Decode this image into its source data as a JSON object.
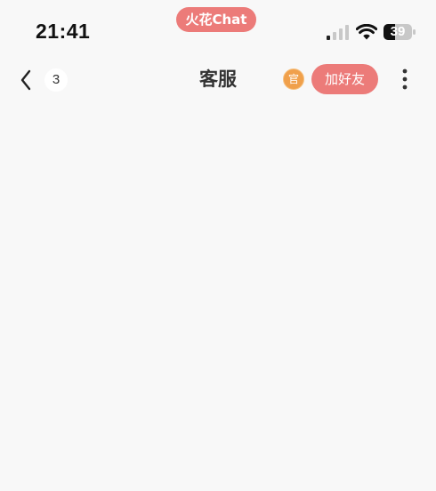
{
  "status_bar": {
    "time": "21:41",
    "app_name": "火花Chat",
    "battery_level": "39",
    "signal_icon": "cellular-signal-icon",
    "wifi_icon": "wifi-icon",
    "battery_icon": "battery-icon"
  },
  "nav": {
    "back_icon": "chevron-left-icon",
    "unread_count": "3",
    "title": "客服",
    "official_badge": "官",
    "add_friend_label": "加好友",
    "more_icon": "vertical-ellipsis-icon"
  },
  "colors": {
    "accent": "#ec7b79",
    "official_badge": "#f0a04b",
    "background": "#f8f8f8"
  }
}
